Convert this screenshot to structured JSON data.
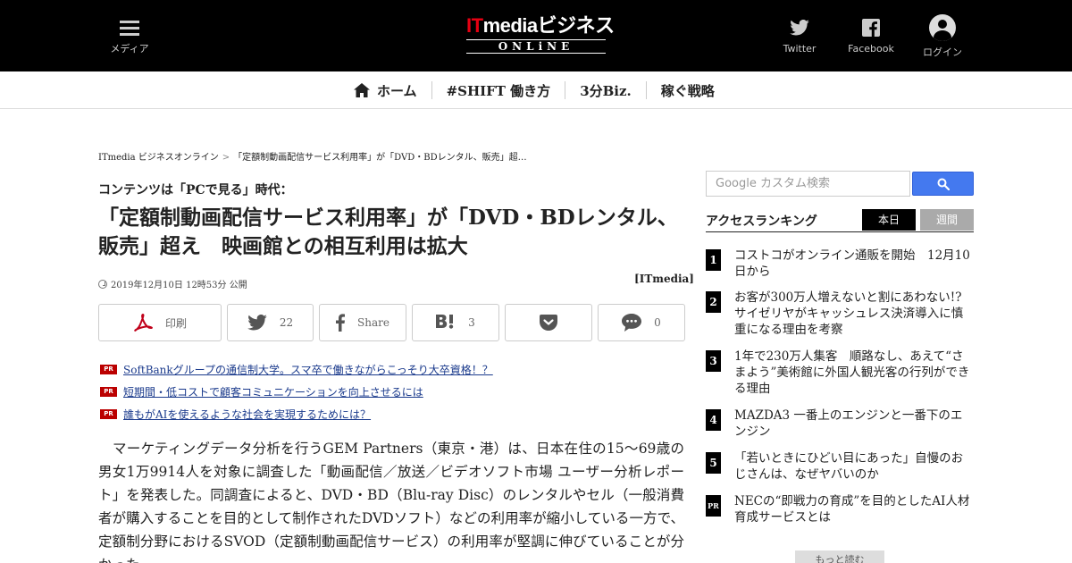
{
  "header": {
    "menu_label": "メディア",
    "logo_it": "IT",
    "logo_main": "mediaビジネス",
    "logo_sub": "ONLiNE",
    "twitter_label": "Twitter",
    "facebook_label": "Facebook",
    "login_label": "ログイン",
    "brand_color": "#e60012"
  },
  "nav": {
    "items": [
      {
        "label": "ホーム",
        "icon": "home-icon"
      },
      {
        "label": "#SHIFT 働き方"
      },
      {
        "label": "3分Biz."
      },
      {
        "label": "稼ぐ戦略"
      }
    ]
  },
  "article": {
    "breadcrumb": [
      "ITmedia ビジネスオンライン",
      "「定額制動画配信サービス利用率」が「DVD・BDレンタル、販売」超…"
    ],
    "breadcrumb_sep": ">",
    "kicker": "コンテンツは「PCで見る」時代：",
    "headline": "「定額制動画配信サービス利用率」が「DVD・BDレンタル、販売」超え　映画館との相互利用は拡大",
    "date": "2019年12月10日 12時53分 公開",
    "source": "[ITmedia]",
    "share": {
      "print_label": "印刷",
      "twitter_count": "22",
      "facebook_label": "Share",
      "hatena_count": "3",
      "comment_count": "0"
    },
    "pr_badge": "PR",
    "pr_links": [
      "SoftBankグループの通信制大学。スマ卒で働きながらこっそり大卒資格！？",
      "短期間・低コストで顧客コミュニケーションを向上させるには",
      "誰もがAIを使えるような社会を実現するためには？"
    ],
    "body": "マーケティングデータ分析を行うGEM Partners（東京・港）は、日本在住の15～69歳の男女1万9914人を対象に調査した「動画配信／放送／ビデオソフト市場 ユーザー分析レポート」を発表した。同調査によると、DVD・BD（Blu-ray Disc）のレンタルやセル（一般消費者が購入することを目的として制作されたDVDソフト）などの利用率が縮小している一方で、定額制分野におけるSVOD（定額制動画配信サービス）の利用率が堅調に伸びていることが分かった。"
  },
  "sidebar": {
    "search_placeholder": "Google カスタム検索",
    "search_button_color": "#4479ef",
    "ranking_title": "アクセスランキング",
    "tab_today": "本日",
    "tab_week": "週間",
    "ranking": [
      {
        "num": "1",
        "text": "コストコがオンライン通販を開始　12月10日から"
      },
      {
        "num": "2",
        "text": "お客が300万人増えないと割にあわない!?　サイゼリヤがキャッシュレス決済導入に慎重になる理由を考察"
      },
      {
        "num": "3",
        "text": "1年で230万人集客　順路なし、あえて“さまよう”美術館に外国人観光客の行列ができる理由"
      },
      {
        "num": "4",
        "text": "MAZDA3 一番上のエンジンと一番下のエンジン"
      },
      {
        "num": "5",
        "text": "「若いときにひどい目にあった」自慢のおじさんは、なぜヤバいのか"
      },
      {
        "num": "PR",
        "text": "NECの“即戦力の育成”を目的としたAI人材育成サービスとは"
      }
    ],
    "more_label": "もっと読む"
  }
}
